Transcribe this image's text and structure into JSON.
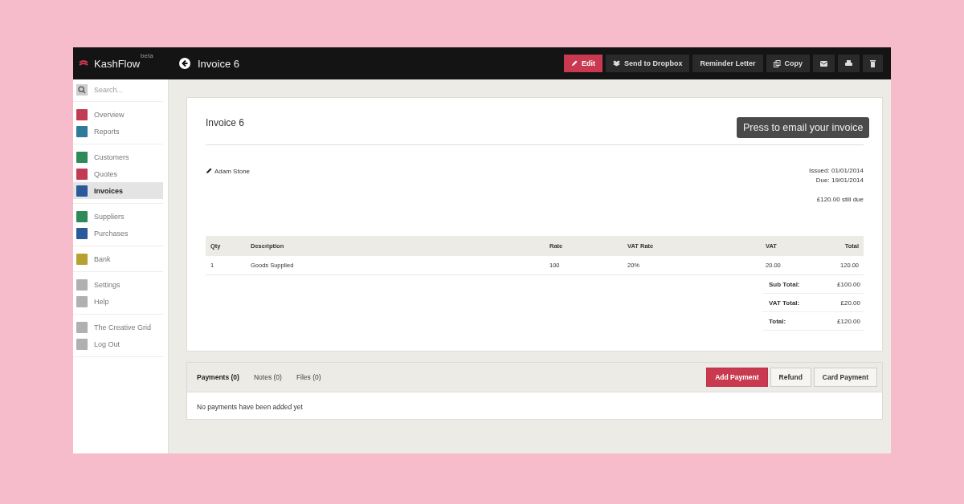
{
  "app": {
    "logo": "KashFlow",
    "badge": "beta"
  },
  "header": {
    "title": "Invoice 6",
    "actions": [
      {
        "label": "Edit",
        "kind": "edit"
      },
      {
        "label": "Send to Dropbox",
        "kind": "dropbox"
      },
      {
        "label": "Reminder Letter",
        "kind": "reminder"
      },
      {
        "label": "Copy",
        "kind": "copy"
      },
      {
        "kind": "email"
      },
      {
        "kind": "print"
      },
      {
        "kind": "delete"
      }
    ]
  },
  "tooltip": "Press to email your invoice",
  "sidebar": {
    "search_placeholder": "Search...",
    "groups": [
      [
        {
          "label": "Overview",
          "color": "#c23b55",
          "selected": false
        },
        {
          "label": "Reports",
          "color": "#2d7a9a",
          "selected": false
        }
      ],
      [
        {
          "label": "Customers",
          "color": "#2f8a5a",
          "selected": false
        },
        {
          "label": "Quotes",
          "color": "#c23b55",
          "selected": false
        },
        {
          "label": "Invoices",
          "color": "#2a5a9a",
          "selected": true
        }
      ],
      [
        {
          "label": "Suppliers",
          "color": "#2f8a5a",
          "selected": false
        },
        {
          "label": "Purchases",
          "color": "#2a5a9a",
          "selected": false
        }
      ],
      [
        {
          "label": "Bank",
          "color": "#b8a030",
          "selected": false
        }
      ],
      [
        {
          "label": "Settings",
          "color": "#b0b0b0",
          "selected": false
        },
        {
          "label": "Help",
          "color": "#b0b0b0",
          "selected": false
        }
      ],
      [
        {
          "label": "The Creative Grid",
          "color": "#b0b0b0",
          "selected": false
        },
        {
          "label": "Log Out",
          "color": "#b0b0b0",
          "selected": false
        }
      ]
    ]
  },
  "invoice": {
    "title": "Invoice 6",
    "customer": "Adam Stone",
    "issued": "Issued: 01/01/2014",
    "due": "Due: 19/01/2014",
    "still_due": "£120.00 still due",
    "columns": [
      "Qty",
      "Description",
      "Rate",
      "VAT Rate",
      "VAT",
      "Total"
    ],
    "rows": [
      [
        "1",
        "Goods Supplied",
        "100",
        "20%",
        "20.00",
        "120.00"
      ]
    ],
    "totals": [
      {
        "label": "Sub Total:",
        "value": "£100.00"
      },
      {
        "label": "VAT Total:",
        "value": "£20.00"
      },
      {
        "label": "Total:",
        "value": "£120.00"
      }
    ]
  },
  "payments": {
    "tabs": [
      {
        "label": "Payments (0)",
        "selected": true
      },
      {
        "label": "Notes (0)",
        "selected": false
      },
      {
        "label": "Files (0)",
        "selected": false
      }
    ],
    "buttons": [
      {
        "label": "Add Payment",
        "kind": "primary"
      },
      {
        "label": "Refund",
        "kind": "plain"
      },
      {
        "label": "Card Payment",
        "kind": "plain"
      }
    ],
    "empty": "No payments have been added yet"
  }
}
